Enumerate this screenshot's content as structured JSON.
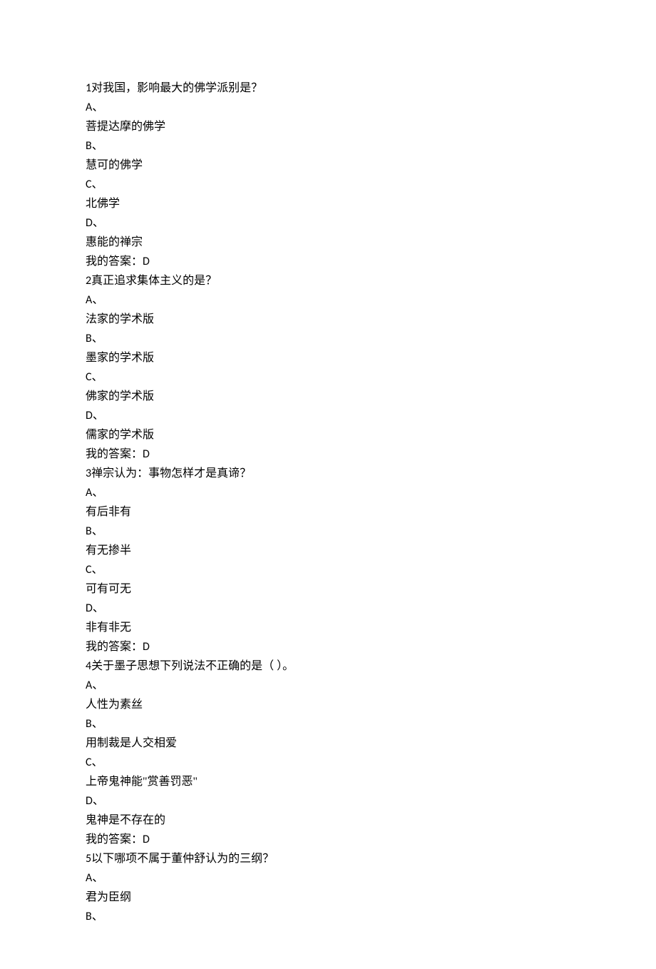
{
  "questions": [
    {
      "number": "1",
      "stem": "对我国，影响最大的佛学派别是？",
      "labels": [
        "A、",
        "B、",
        "C、",
        "D、"
      ],
      "options": [
        "菩提达摩的佛学",
        "慧可的佛学",
        "北佛学",
        "惠能的禅宗"
      ],
      "answer_prefix": "我的答案：",
      "answer": "D"
    },
    {
      "number": "2",
      "stem": "真正追求集体主义的是？",
      "labels": [
        "A、",
        "B、",
        "C、",
        "D、"
      ],
      "options": [
        "法家的学术版",
        "墨家的学术版",
        "佛家的学术版",
        "儒家的学术版"
      ],
      "answer_prefix": "我的答案：",
      "answer": "D"
    },
    {
      "number": "3",
      "stem": "禅宗认为：事物怎样才是真谛？",
      "labels": [
        "A、",
        "B、",
        "C、",
        "D、"
      ],
      "options": [
        "有后非有",
        "有无掺半",
        "可有可无",
        "非有非无"
      ],
      "answer_prefix": "我的答案：",
      "answer": "D"
    },
    {
      "number": "4",
      "stem": "关于墨子思想下列说法不正确的是（ ）。",
      "labels": [
        "A、",
        "B、",
        "C、",
        "D、"
      ],
      "options": [
        "人性为素丝",
        "用制裁是人交相爱",
        "上帝鬼神能\"赏善罚恶\"",
        "鬼神是不存在的"
      ],
      "answer_prefix": "我的答案：",
      "answer": "D"
    },
    {
      "number": "5",
      "stem": "以下哪项不属于董仲舒认为的三纲？",
      "labels": [
        "A、",
        "B、"
      ],
      "options": [
        "君为臣纲"
      ],
      "answer_prefix": "",
      "answer": ""
    }
  ]
}
